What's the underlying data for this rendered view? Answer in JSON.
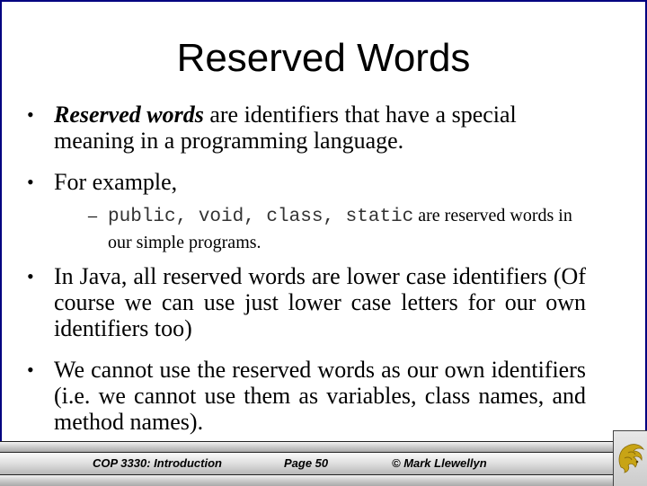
{
  "slide": {
    "title": "Reserved Words",
    "bullets": [
      {
        "emphasis": "Reserved words",
        "text": " are identifiers that have a special meaning in a programming language."
      },
      {
        "text": "For example,"
      },
      {
        "text": "In Java, all reserved words are lower case identifiers (Of course we can use just lower case letters for our own identifiers too)"
      },
      {
        "text": "We cannot use the reserved words as our own identifiers (i.e. we cannot use them as variables, class names, and method names)."
      }
    ],
    "sub_bullet": {
      "dash": "–",
      "code": "public, void, class, static",
      "text": " are reserved words in our simple programs."
    },
    "bullet_glyph": "•"
  },
  "footer": {
    "course": "COP 3330: Introduction",
    "page": "Page 50",
    "author": "© Mark Llewellyn",
    "logo": "pegasus-logo-icon"
  },
  "colors": {
    "border": "#000080",
    "logo_gold": "#c8a415"
  }
}
